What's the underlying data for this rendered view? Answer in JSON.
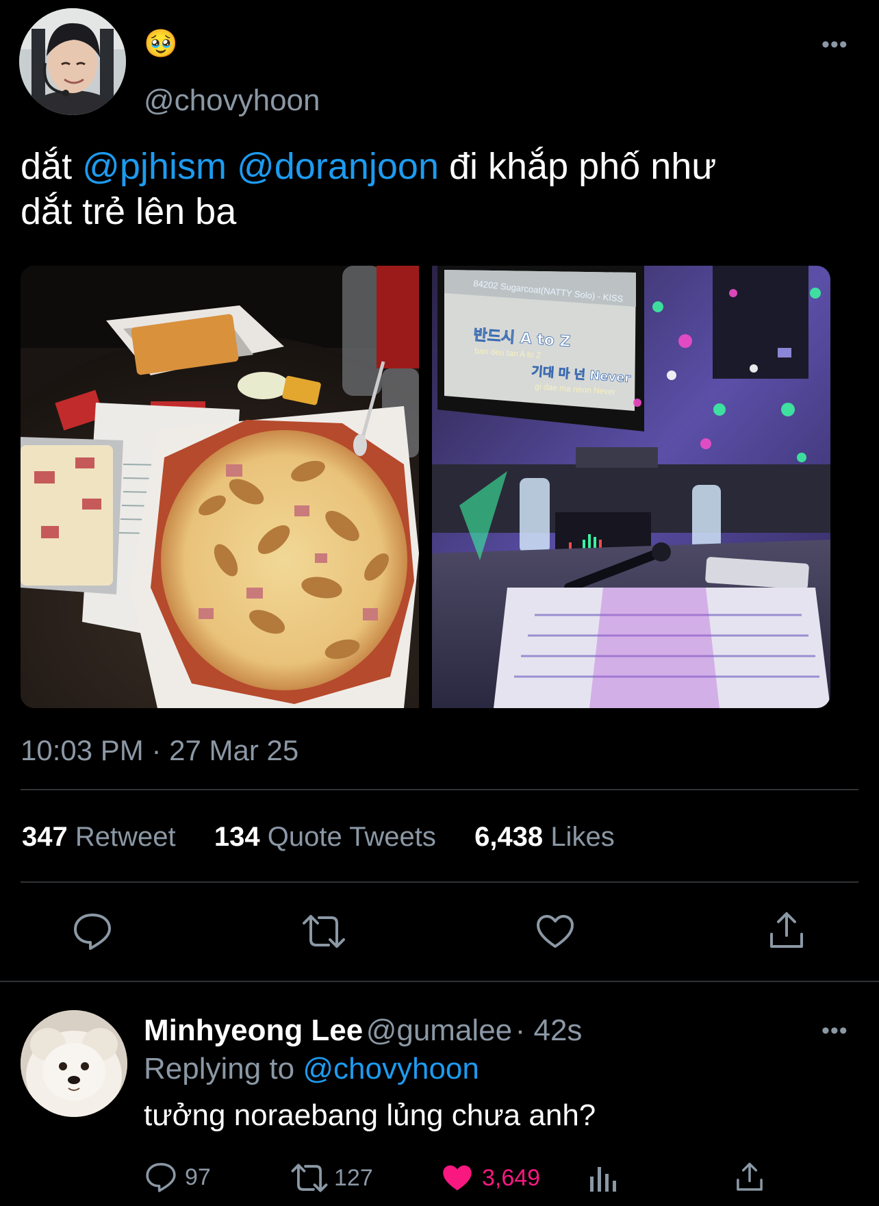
{
  "tweet": {
    "emoji": "🥹",
    "handle": "@chovyhoon",
    "text_parts": [
      "dắt ",
      "@pjhism",
      " ",
      "@doranjoon",
      " đi khắp phố như",
      "dắt trẻ lên ba"
    ],
    "time": "10:03 PM · 27 Mar 25",
    "more_label": "•••",
    "stats": {
      "retweets_count": "347",
      "retweets_label": "Retweet",
      "quotes_count": "134",
      "quotes_label": "Quote Tweets",
      "likes_count": "6,438",
      "likes_label": "Likes"
    },
    "actions": [
      "reply-icon",
      "retweet-icon",
      "like-icon",
      "share-icon"
    ]
  },
  "media": {
    "karaoke_screen": {
      "song": "84202 Sugarcoat(NATTY Solo) - KISS",
      "line1": "반드시 A to Z",
      "line1_rom": "ban deu tan A to Z",
      "line2": "기대 마 넌 Never",
      "line2_rom": "gi dae ma neon Never"
    }
  },
  "reply": {
    "name": "Minhyeong Lee",
    "handle": "@gumalee",
    "time": "· 42s",
    "replying_prefix": "Replying to ",
    "replying_handle": "@chovyhoon",
    "text": "tưởng noraebang lủng chưa anh?",
    "more_label": "•••",
    "replies": "97",
    "retweets": "127",
    "likes": "3,649"
  },
  "colors": {
    "background": "#000000",
    "accent": "#1d9bf0",
    "muted": "#8b98a5",
    "like": "#f91880",
    "divider": "#2f3336"
  }
}
